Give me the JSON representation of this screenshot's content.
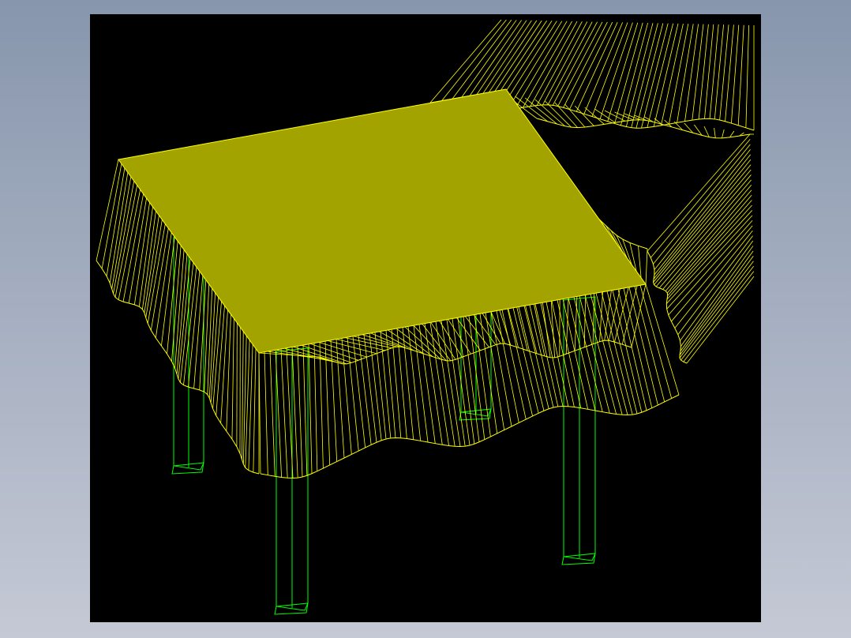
{
  "model": {
    "colors": {
      "tabletop_fill": "#a3a300",
      "cloth_wire": "#ffff00",
      "legs_wire": "#00ff00",
      "viewport_bg": "#000000"
    }
  }
}
